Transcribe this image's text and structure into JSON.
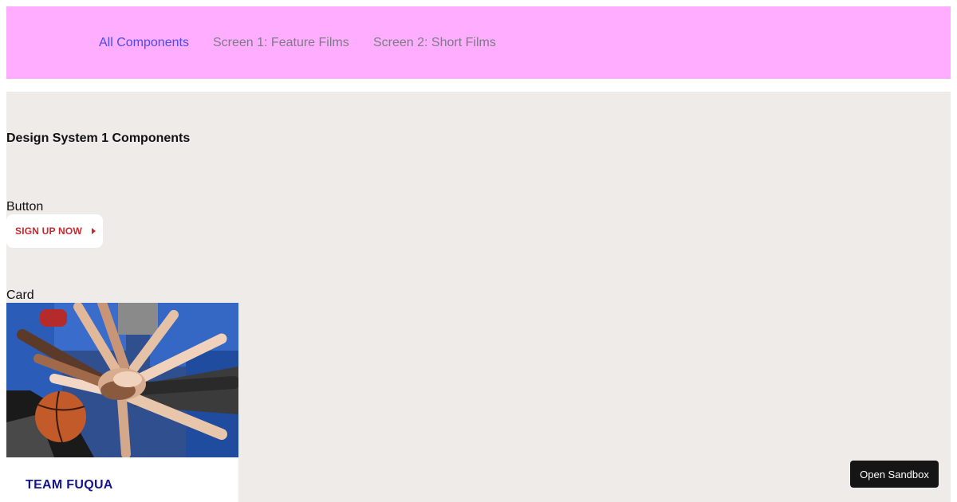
{
  "nav": {
    "links": [
      {
        "label": "All Components",
        "active": true
      },
      {
        "label": "Screen 1: Feature Films",
        "active": false
      },
      {
        "label": "Screen 2: Short Films",
        "active": false
      }
    ]
  },
  "main": {
    "title": "Design System 1 Components",
    "button_section": {
      "label": "Button",
      "cta": {
        "label": "SIGN UP NOW",
        "icon": "caret-right-icon"
      }
    },
    "card_section": {
      "label": "Card",
      "card": {
        "image": "team-hands-together-photo",
        "title": "TEAM FUQUA"
      }
    }
  },
  "sandbox": {
    "label": "Open Sandbox"
  },
  "colors": {
    "nav_bg": "#ffaeff",
    "main_bg": "#efebe8",
    "active_link": "#4b4bf0",
    "inactive_link": "#7c7c84",
    "cta_text": "#c8292f",
    "card_title": "#16168c",
    "sandbox_bg": "#151515"
  }
}
